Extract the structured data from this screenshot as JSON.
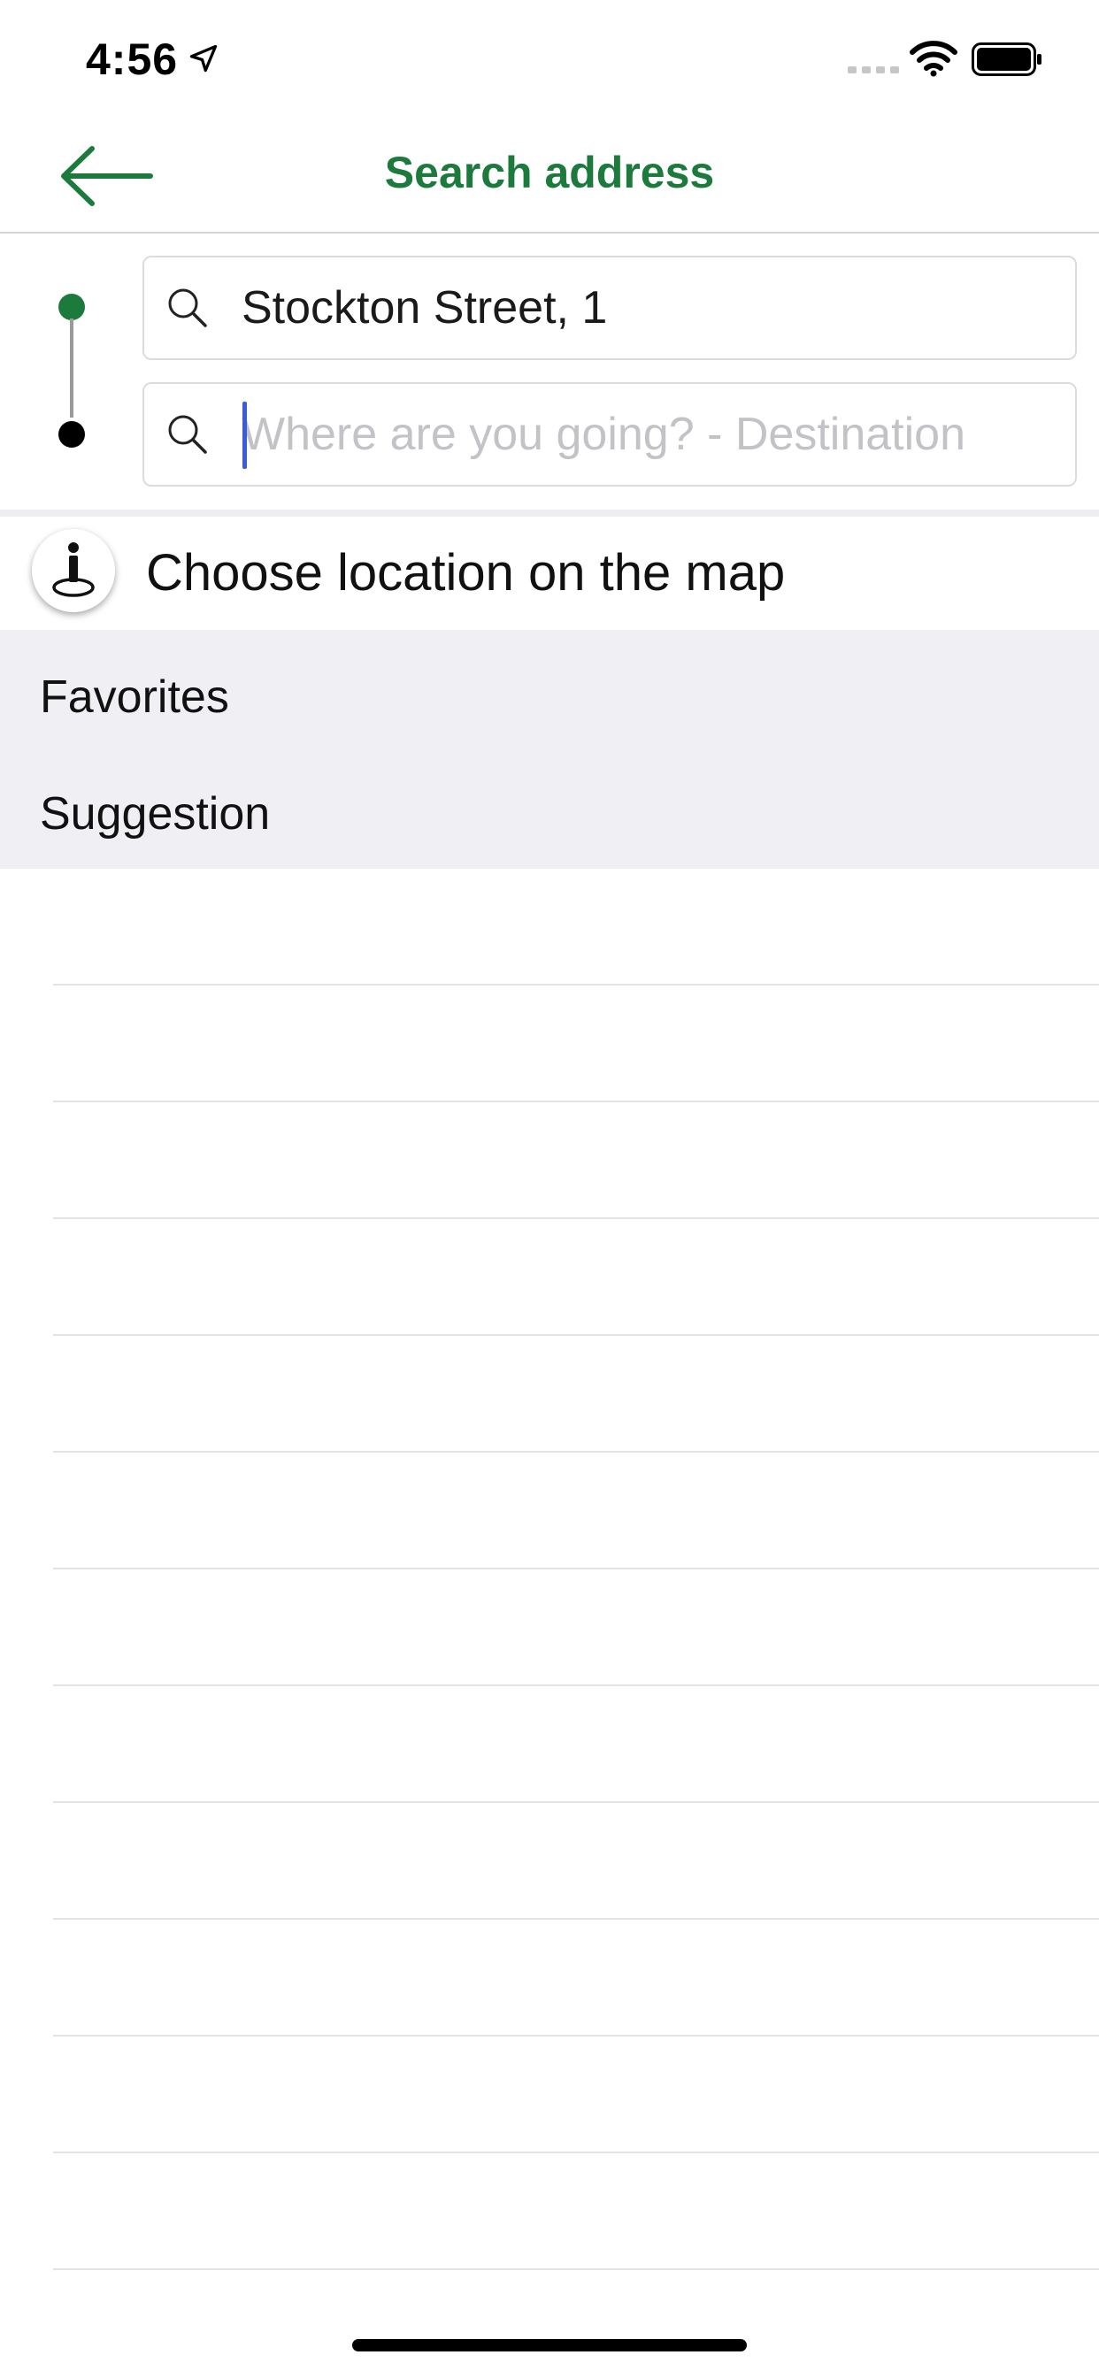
{
  "status_bar": {
    "time": "4:56",
    "location_icon": "location-arrow-icon",
    "signal_icon": "cellular-signal-icon",
    "wifi_icon": "wifi-icon",
    "battery_icon": "battery-icon"
  },
  "nav": {
    "back_icon": "arrow-left-icon",
    "title": "Search address"
  },
  "route": {
    "origin": {
      "value": "Stockton Street, 1",
      "icon": "search-icon"
    },
    "destination": {
      "value": "",
      "placeholder": "Where are you going? - Destination",
      "icon": "search-icon"
    }
  },
  "map_option": {
    "icon": "map-pin-person-icon",
    "label": "Choose location on the map"
  },
  "sections": {
    "favorites": "Favorites",
    "suggestion": "Suggestion"
  },
  "colors": {
    "accent": "#1b7a3c",
    "caret": "#3b5bdb",
    "section_background": "#efeff4",
    "origin_dot": "#1b7a3c",
    "destination_dot": "#000000"
  }
}
